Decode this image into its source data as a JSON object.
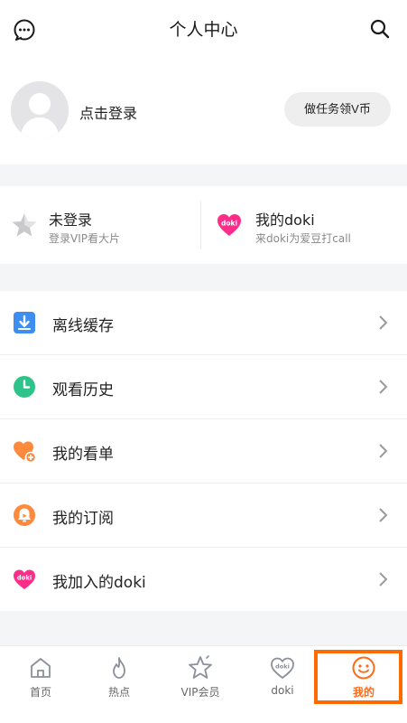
{
  "header": {
    "title": "个人中心",
    "left_icon": "message-icon",
    "right_icon": "search-icon"
  },
  "profile": {
    "login_label": "点击登录",
    "task_button_label": "做任务领V币"
  },
  "cards": [
    {
      "title": "未登录",
      "subtitle": "登录VIP看大片",
      "icon": "star-icon"
    },
    {
      "title": "我的doki",
      "subtitle": "来doki为爱豆打call",
      "icon": "doki-icon"
    }
  ],
  "menu": [
    {
      "label": "离线缓存",
      "icon": "download-icon"
    },
    {
      "label": "观看历史",
      "icon": "clock-icon"
    },
    {
      "label": "我的看单",
      "icon": "heart-plus-icon"
    },
    {
      "label": "我的订阅",
      "icon": "subscribe-icon"
    },
    {
      "label": "我加入的doki",
      "icon": "doki-icon"
    }
  ],
  "tabs": [
    {
      "label": "首页",
      "icon": "home-icon"
    },
    {
      "label": "热点",
      "icon": "flame-icon"
    },
    {
      "label": "VIP会员",
      "icon": "vip-star-icon"
    },
    {
      "label": "doki",
      "icon": "doki-heart-icon"
    },
    {
      "label": "我的",
      "icon": "smile-icon",
      "active": true
    }
  ],
  "colors": {
    "accent": "#ff6a1a",
    "highlight_box": "#ff6a00",
    "doki_pink": "#ff2d8a",
    "download_blue": "#3d8ef0",
    "history_green": "#2ec38a",
    "watchlist_orange": "#ff8a3d",
    "subscribe_orange": "#ff8a3d"
  }
}
